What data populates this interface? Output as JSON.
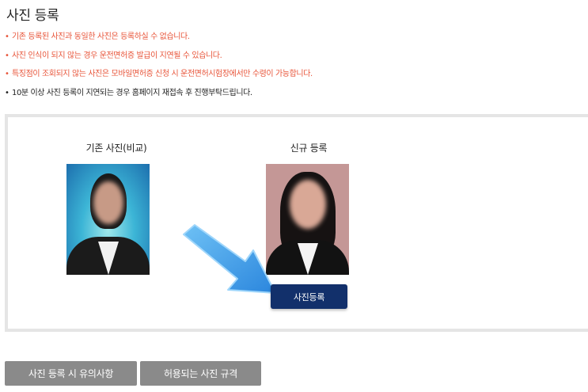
{
  "page": {
    "title": "사진 등록"
  },
  "notices": [
    {
      "text": "기존 등록된 사진과 동일한 사진은 등록하실 수 없습니다.",
      "color": "#e8553a"
    },
    {
      "text": "사진 인식이 되지 않는 경우 운전면허증 발급이 지연될 수 있습니다.",
      "color": "#e8553a"
    },
    {
      "text": "특징점이 조회되지 않는 사진은 모바일면허증 신청 시 운전면허시험장에서만 수령이 가능합니다.",
      "color": "#e8553a"
    },
    {
      "text": "10분 이상 사진 등록이 지연되는 경우 홈페이지 재접속 후 진행부탁드립니다.",
      "color": "#222222"
    }
  ],
  "photos": {
    "existing_caption": "기존 사진(비교)",
    "new_caption": "신규 등록",
    "register_button": "사진등록"
  },
  "buttons": {
    "precautions": "사진 등록 시 유의사항",
    "allowed_spec": "허용되는 사진 규격"
  },
  "colors": {
    "accent_blue": "#12306b",
    "warning_red": "#e8553a",
    "button_gray": "#8a8a8a",
    "arrow_blue": "#3f9ee8"
  }
}
